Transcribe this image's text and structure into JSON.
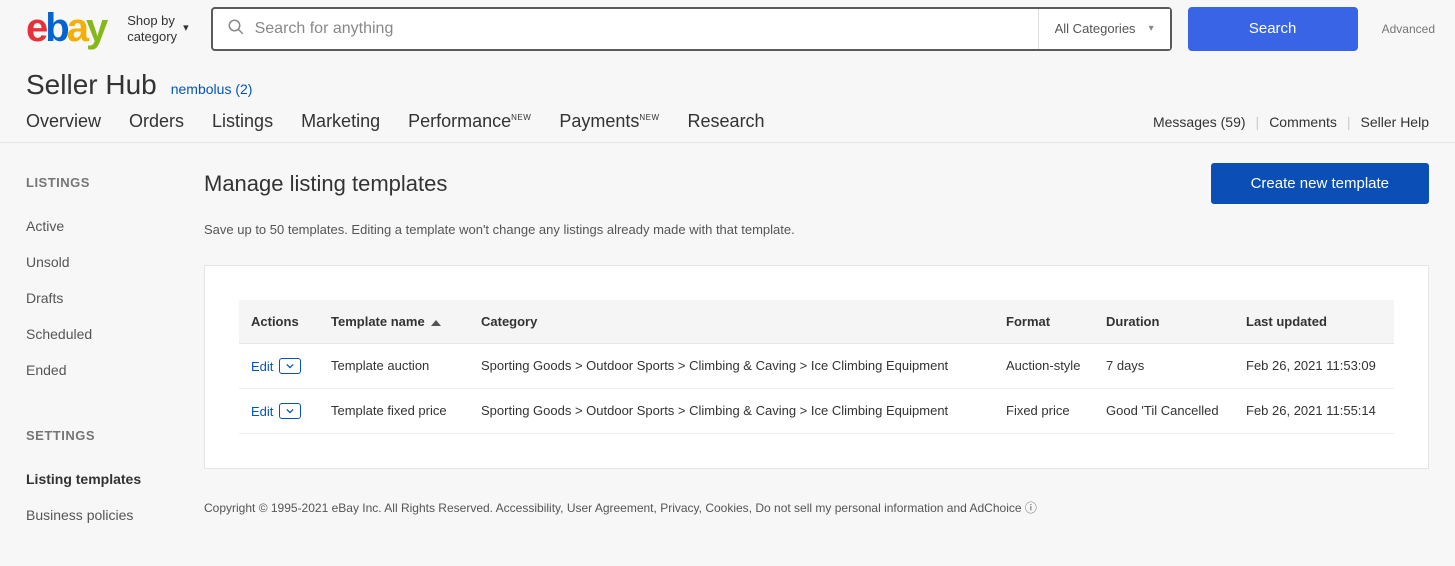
{
  "header": {
    "shop_by_line1": "Shop by",
    "shop_by_line2": "category",
    "search_placeholder": "Search for anything",
    "category_selected": "All Categories",
    "search_button": "Search",
    "advanced": "Advanced"
  },
  "sub": {
    "seller_hub": "Seller Hub",
    "username": "nembolus",
    "count_paren": "(2)"
  },
  "nav": {
    "overview": "Overview",
    "orders": "Orders",
    "listings": "Listings",
    "marketing": "Marketing",
    "performance": "Performance",
    "payments": "Payments",
    "research": "Research",
    "new_sup": "NEW"
  },
  "right": {
    "messages": "Messages (59)",
    "comments": "Comments",
    "seller_help": "Seller Help"
  },
  "sidebar": {
    "listings_heading": "LISTINGS",
    "items": [
      "Active",
      "Unsold",
      "Drafts",
      "Scheduled",
      "Ended"
    ],
    "settings_heading": "SETTINGS",
    "settings_items": [
      "Listing templates",
      "Business policies"
    ]
  },
  "main": {
    "title": "Manage listing templates",
    "create_btn": "Create new template",
    "subtext": "Save up to 50 templates. Editing a template won't change any listings already made with that template."
  },
  "table": {
    "headers": {
      "actions": "Actions",
      "name": "Template name",
      "category": "Category",
      "format": "Format",
      "duration": "Duration",
      "updated": "Last updated"
    },
    "edit_label": "Edit",
    "rows": [
      {
        "name": "Template auction",
        "category": "Sporting Goods > Outdoor Sports > Climbing & Caving > Ice Climbing Equipment",
        "format": "Auction-style",
        "duration": "7 days",
        "updated": "Feb 26, 2021 11:53:09"
      },
      {
        "name": "Template fixed price",
        "category": "Sporting Goods > Outdoor Sports > Climbing & Caving > Ice Climbing Equipment",
        "format": "Fixed price",
        "duration": "Good 'Til Cancelled",
        "updated": "Feb 26, 2021 11:55:14"
      }
    ]
  },
  "footer": {
    "text1": "Copyright © 1995-2021 eBay Inc. All Rights Reserved. ",
    "accessibility": "Accessibility",
    "user_agreement": "User Agreement",
    "privacy": "Privacy",
    "cookies": "Cookies",
    "do_not_sell": "Do not sell my personal information",
    "and": " and ",
    "adchoice": "AdChoice",
    "comma": ", "
  }
}
